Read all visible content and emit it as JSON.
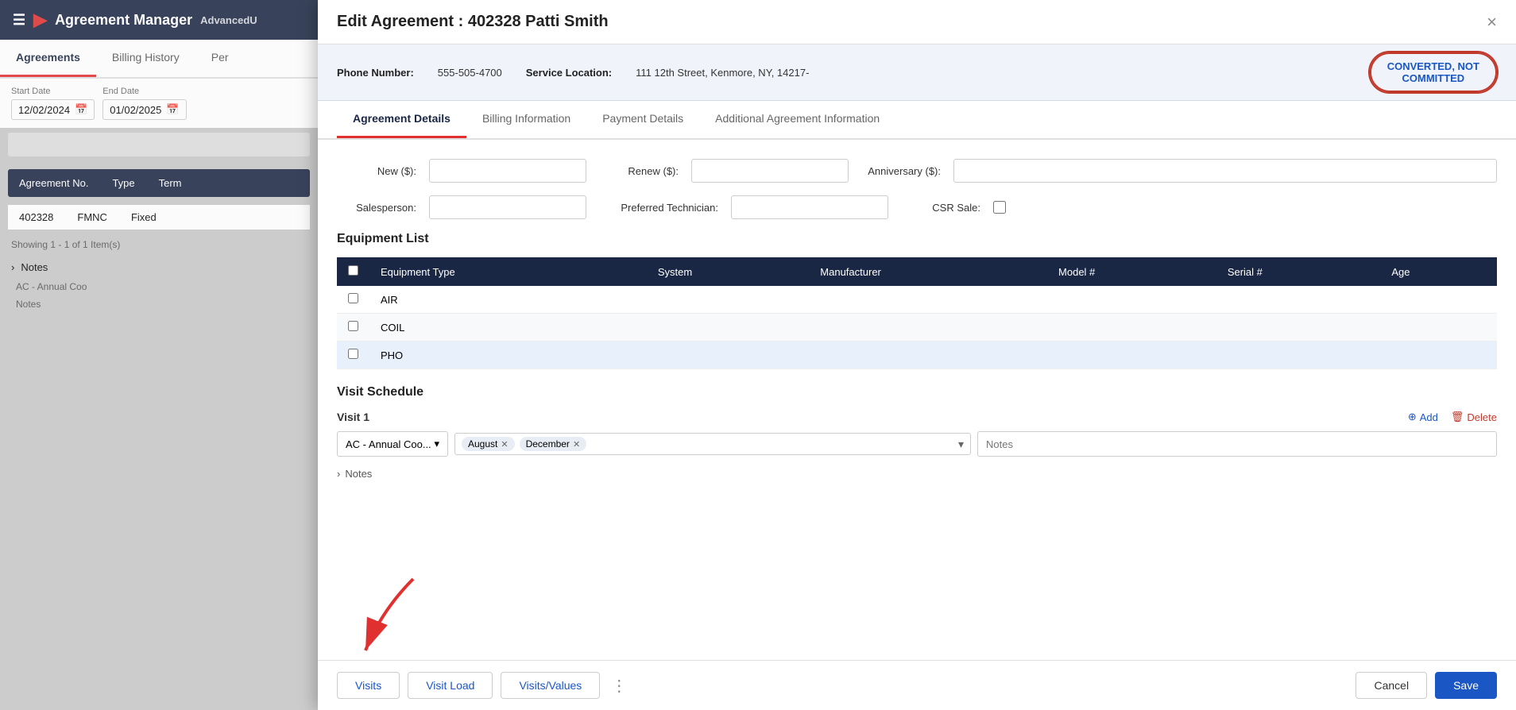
{
  "app": {
    "title": "Agreement Manager",
    "advanced_label": "AdvancedU"
  },
  "background": {
    "tabs": [
      {
        "label": "Agreements",
        "active": true
      },
      {
        "label": "Billing History",
        "active": false
      },
      {
        "label": "Per",
        "active": false
      }
    ],
    "start_date_label": "Start Date",
    "start_date_value": "12/02/2024",
    "end_date_label": "End Date",
    "end_date_value": "01/02/2025",
    "table_headers": [
      "Agreement No.",
      "Type",
      "Term"
    ],
    "table_row": [
      "402328",
      "FMNC",
      "Fixed"
    ],
    "showing_text": "Showing 1 - 1 of 1 Item(s)",
    "notes_label": "Notes",
    "notes_items": [
      {
        "label": "AC - Annual Coo"
      },
      {
        "label": "Notes"
      }
    ]
  },
  "modal": {
    "title": "Edit Agreement : 402328 Patti Smith",
    "close_label": "×",
    "info": {
      "phone_label": "Phone Number:",
      "phone_value": "555-505-4700",
      "location_label": "Service Location:",
      "location_value": "111 12th Street, Kenmore, NY, 14217-"
    },
    "status_badge": "CONVERTED, NOT\nCOMMITTED",
    "tabs": [
      {
        "label": "Agreement Details",
        "active": true
      },
      {
        "label": "Billing Information",
        "active": false
      },
      {
        "label": "Payment Details",
        "active": false
      },
      {
        "label": "Additional Agreement Information",
        "active": false
      }
    ],
    "form": {
      "new_label": "New ($):",
      "new_placeholder": "",
      "renew_label": "Renew ($):",
      "renew_placeholder": "",
      "anniversary_label": "Anniversary ($):",
      "anniversary_placeholder": "",
      "salesperson_label": "Salesperson:",
      "salesperson_placeholder": "",
      "preferred_tech_label": "Preferred Technician:",
      "preferred_tech_placeholder": "",
      "csr_sale_label": "CSR Sale:"
    },
    "equipment": {
      "section_title": "Equipment List",
      "columns": [
        "",
        "Equipment Type",
        "System",
        "Manufacturer",
        "Model #",
        "Serial #",
        "Age"
      ],
      "rows": [
        {
          "type": "AIR"
        },
        {
          "type": "COIL"
        },
        {
          "type": "PHO"
        }
      ]
    },
    "visit_schedule": {
      "section_title": "Visit Schedule",
      "visit_label": "Visit 1",
      "add_label": "Add",
      "delete_label": "Delete",
      "service_type": "AC - Annual Coo...",
      "months": [
        "August",
        "December"
      ],
      "notes_placeholder": "Notes",
      "notes_expand_label": "Notes"
    },
    "footer": {
      "visits_label": "Visits",
      "visit_load_label": "Visit Load",
      "visits_values_label": "Visits/Values",
      "cancel_label": "Cancel",
      "save_label": "Save"
    }
  }
}
